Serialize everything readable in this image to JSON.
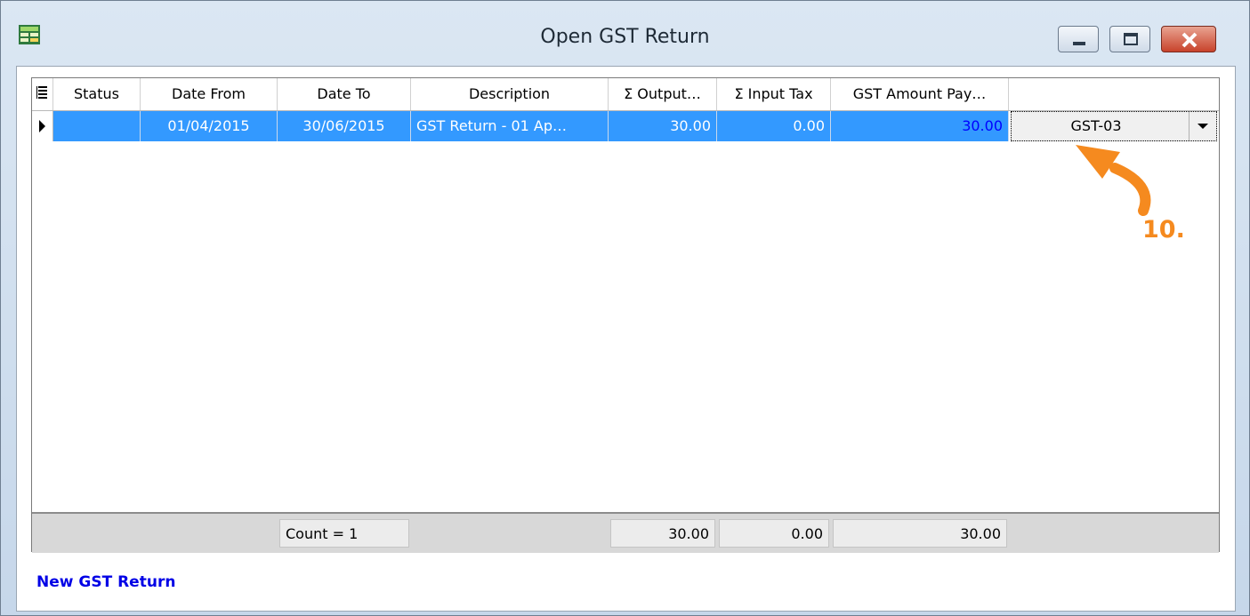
{
  "window": {
    "title": "Open GST Return",
    "icon": "gst-app-icon",
    "controls": {
      "minimize": "minimize-icon",
      "maximize": "maximize-icon",
      "close": "close-icon"
    }
  },
  "grid": {
    "columns": [
      "Status",
      "Date From",
      "Date To",
      "Description",
      "Σ Output…",
      "Σ Input Tax",
      "GST Amount Pay…"
    ],
    "rows": [
      {
        "status": "",
        "date_from": "01/04/2015",
        "date_to": "30/06/2015",
        "description": "GST Return - 01 Ap…",
        "output": "30.00",
        "input_tax": "0.00",
        "gst_payable": "30.00",
        "form": "GST-03"
      }
    ],
    "footer": {
      "count": "Count = 1",
      "output_total": "30.00",
      "input_total": "0.00",
      "payable_total": "30.00"
    },
    "selection_color": "#3399ff",
    "payable_text_color": "#0000ff"
  },
  "actions": {
    "new_return": "New GST Return"
  },
  "annotation": {
    "label": "10.",
    "color": "#f58a1f"
  }
}
